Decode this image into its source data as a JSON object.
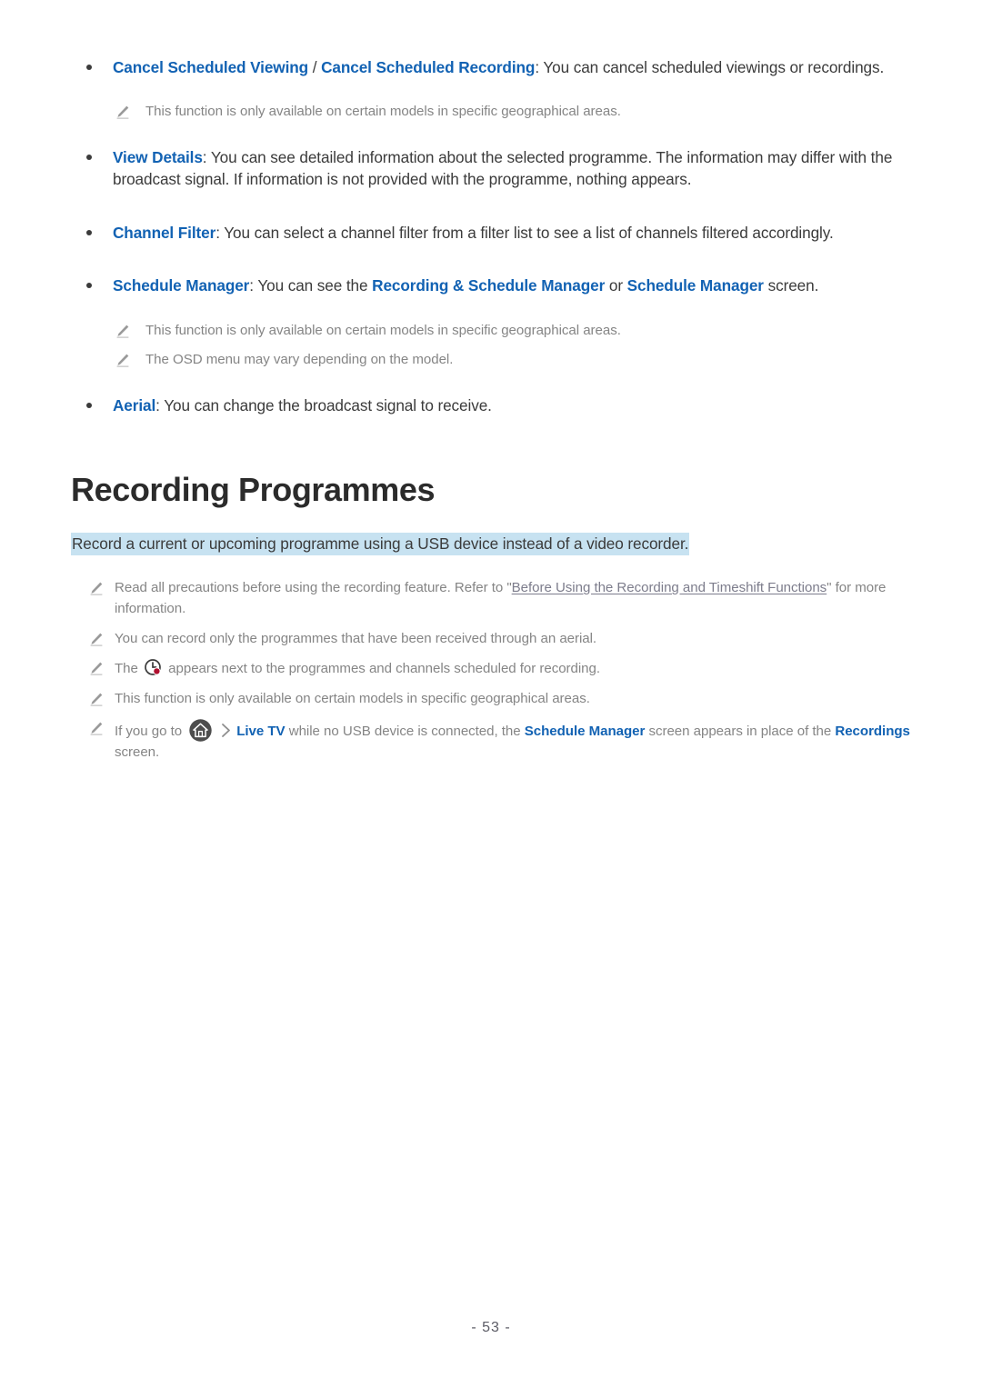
{
  "page": {
    "number_label": "- 53 -"
  },
  "colors": {
    "link_blue": "#1262b3",
    "body_text": "#3b3b3b",
    "note_text": "#858585",
    "highlight_bg": "#c7e2f1",
    "underline_link": "#7d7d8c",
    "clock_icon_accent": "#b01030",
    "home_icon_bg": "#4d4d4d"
  },
  "top_section": {
    "bullets": [
      {
        "id": "cancel-scheduled",
        "link_a": "Cancel Scheduled Viewing",
        "separator": " / ",
        "link_b": "Cancel Scheduled Recording",
        "text": ": You can cancel scheduled viewings or recordings.",
        "notes": [
          "This function is only available on certain models in specific geographical areas."
        ]
      },
      {
        "id": "view-details",
        "link_a": "View Details",
        "text": ": You can see detailed information about the selected programme. The information may differ with the broadcast signal. If information is not provided with the programme, nothing appears.",
        "notes": []
      },
      {
        "id": "channel-filter",
        "link_a": "Channel Filter",
        "text": ": You can select a channel filter from a filter list to see a list of channels filtered accordingly.",
        "notes": []
      },
      {
        "id": "schedule-manager",
        "link_a": "Schedule Manager",
        "text_1": ": You can see the ",
        "link_b": "Recording & Schedule Manager",
        "text_2": " or ",
        "link_c": "Schedule Manager",
        "text_3": " screen.",
        "notes": [
          "This function is only available on certain models in specific geographical areas.",
          "The OSD menu may vary depending on the model."
        ]
      },
      {
        "id": "aerial",
        "link_a": "Aerial",
        "text": ": You can change the broadcast signal to receive.",
        "notes": []
      }
    ]
  },
  "recording_section": {
    "heading": "Recording Programmes",
    "highlight": "Record a current or upcoming programme using a USB device instead of a video recorder.",
    "notes": [
      {
        "id": "precautions",
        "text_1": "Read all precautions before using the recording feature. Refer to \"",
        "underlined_link": "Before Using the Recording and Timeshift Functions",
        "text_2": "\" for more information."
      },
      {
        "id": "aerial-only",
        "text_1": "You can record only the programmes that have been received through an aerial."
      },
      {
        "id": "clock-icon-note",
        "text_1": "The ",
        "icon": "clock-record-icon",
        "text_2": " appears next to the programmes and channels scheduled for recording."
      },
      {
        "id": "geo-limited",
        "text_1": "This function is only available on certain models in specific geographical areas."
      },
      {
        "id": "no-usb",
        "text_1": "If you go to ",
        "icon_home": "home-icon",
        "icon_chevron": "chevron-right-icon",
        "link_a": "Live TV",
        "text_2": " while no USB device is connected, the ",
        "link_b": "Schedule Manager",
        "text_3": " screen appears in place of the ",
        "link_c": "Recordings",
        "text_4": " screen."
      }
    ]
  }
}
